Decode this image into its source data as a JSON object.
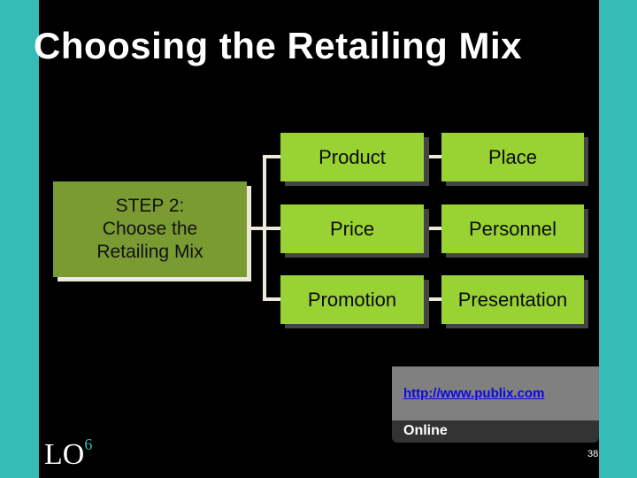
{
  "slide": {
    "title": "Choosing the Retailing Mix",
    "step": {
      "line1": "STEP 2:",
      "line2": "Choose the",
      "line3": "Retailing Mix"
    },
    "mix_items": [
      {
        "left": "Product",
        "right": "Place"
      },
      {
        "left": "Price",
        "right": "Personnel"
      },
      {
        "left": "Promotion",
        "right": "Presentation"
      }
    ],
    "web": {
      "link": "http://www.publix.com",
      "label": "Online"
    },
    "lo": {
      "text": "LO",
      "number": "6"
    },
    "page_number": "38",
    "colors": {
      "teal": "#36bcb6",
      "step_green": "#7a9b32",
      "box_green": "#99d233",
      "link_blue": "#0a0adc"
    }
  }
}
